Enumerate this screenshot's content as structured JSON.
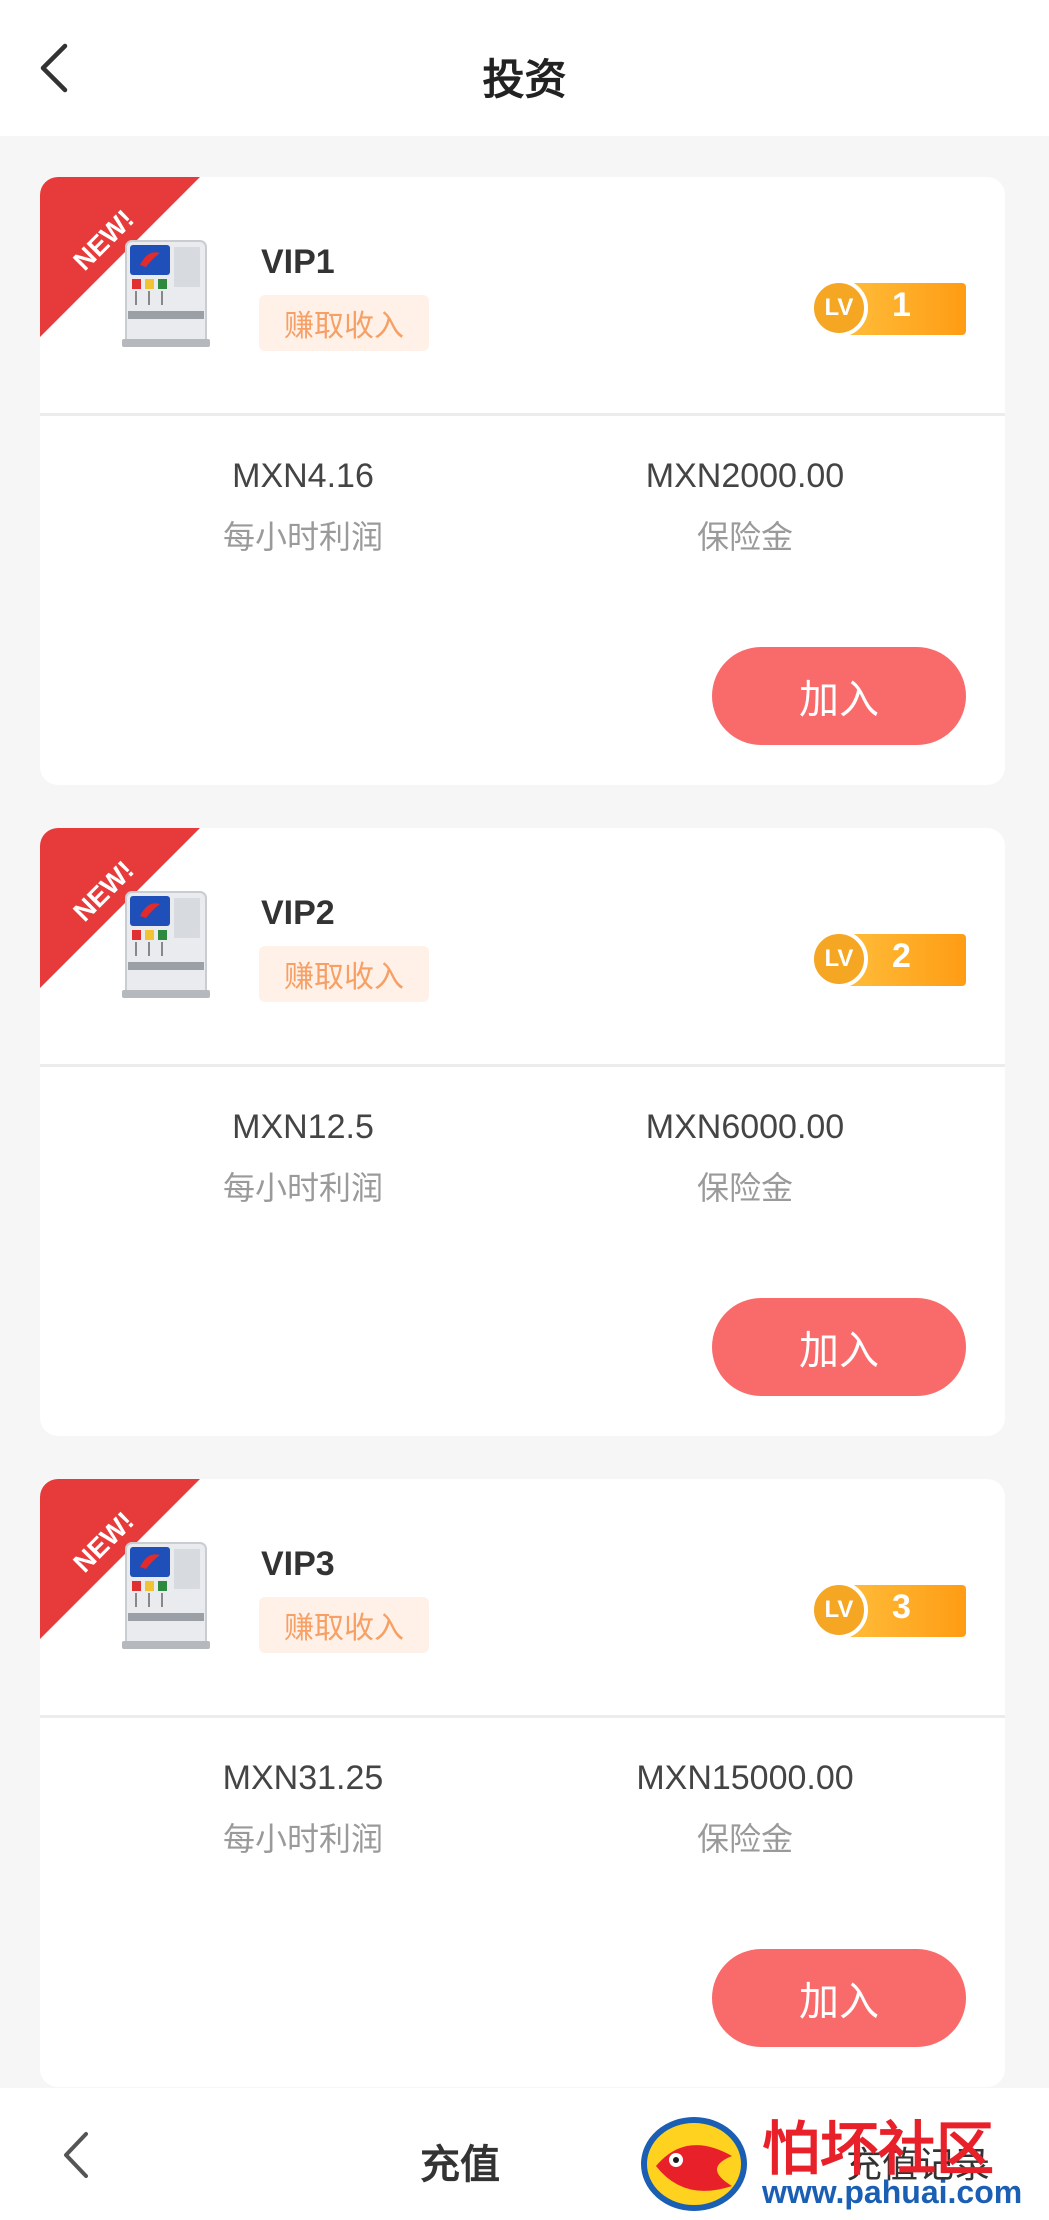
{
  "header": {
    "title": "投资"
  },
  "plans": [
    {
      "name": "VIP1",
      "tag": "赚取收入",
      "ribbon": "NEW!",
      "lv_label": "LV",
      "level": "1",
      "profit_value": "MXN4.16",
      "profit_label": "每小时利润",
      "deposit_value": "MXN2000.00",
      "deposit_label": "保险金",
      "join_label": "加入"
    },
    {
      "name": "VIP2",
      "tag": "赚取收入",
      "ribbon": "NEW!",
      "lv_label": "LV",
      "level": "2",
      "profit_value": "MXN12.5",
      "profit_label": "每小时利润",
      "deposit_value": "MXN6000.00",
      "deposit_label": "保险金",
      "join_label": "加入"
    },
    {
      "name": "VIP3",
      "tag": "赚取收入",
      "ribbon": "NEW!",
      "lv_label": "LV",
      "level": "3",
      "profit_value": "MXN31.25",
      "profit_label": "每小时利润",
      "deposit_value": "MXN15000.00",
      "deposit_label": "保险金",
      "join_label": "加入"
    }
  ],
  "bottom": {
    "title": "充值",
    "right_label": "充值记录"
  },
  "watermark": {
    "text": "怕坏社区",
    "url": "www.pahuai.com"
  },
  "colors": {
    "accent": "#f96b6b",
    "ribbon": "#e73b3b",
    "level": "#ff9c14",
    "tag_text": "#f6a066"
  },
  "icons": {
    "back": "chevron-left-icon",
    "product": "drink-dispenser-icon"
  }
}
